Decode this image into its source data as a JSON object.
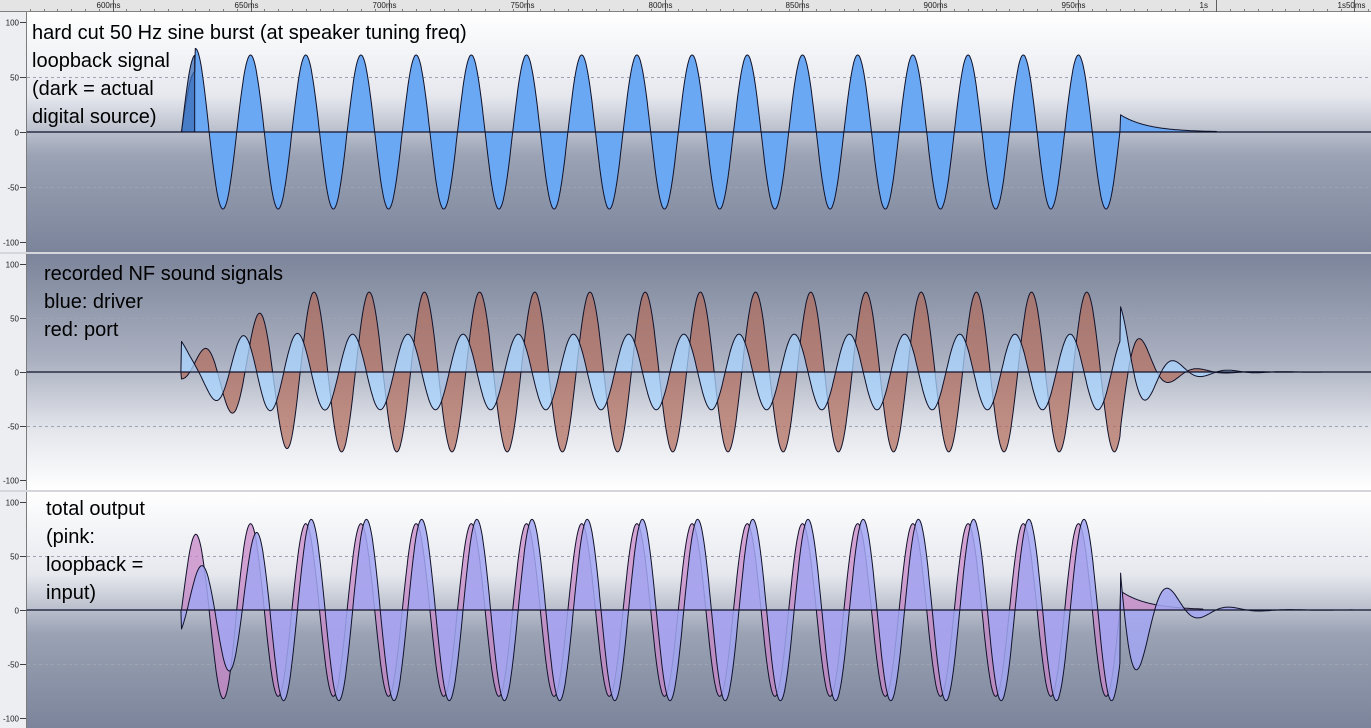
{
  "window": {
    "time_ruler": {
      "ticks": [
        {
          "t": 600,
          "label": "600ms"
        },
        {
          "t": 650,
          "label": "650ms"
        },
        {
          "t": 700,
          "label": "700ms"
        },
        {
          "t": 750,
          "label": "750ms"
        },
        {
          "t": 800,
          "label": "800ms"
        },
        {
          "t": 850,
          "label": "850ms"
        },
        {
          "t": 900,
          "label": "900ms"
        },
        {
          "t": 950,
          "label": "950ms"
        },
        {
          "t": 1000,
          "label": "1s"
        },
        {
          "t": 1050,
          "label": "1s50ms"
        }
      ]
    }
  },
  "colors": {
    "loopback_fill": "#6aa8f4",
    "loopback_dark": "#3c6fb8",
    "driver_fill": "#a8d4ff",
    "port_fill": "#b06a58",
    "total_fill": "#a2a6f2",
    "pink_fill": "#c888c8",
    "trace_line": "#10122a",
    "grid_line": "#a0a4b0"
  },
  "tracks": [
    {
      "annotation": [
        "hard cut 50 Hz sine burst (at speaker tuning freq)",
        "loopback signal",
        "(dark = actual",
        "digital source)"
      ]
    },
    {
      "annotation": [
        "recorded NF sound signals",
        "blue: driver",
        "red: port"
      ]
    },
    {
      "annotation": [
        "total output",
        "(pink:",
        "loopback =",
        "input)"
      ]
    }
  ],
  "chart_data": [
    {
      "type": "line",
      "title": "",
      "xlabel": "",
      "ylabel": "",
      "xlim": [
        569,
        1056
      ],
      "ylim": [
        -100,
        100
      ],
      "yticks": [
        {
          "v": 100,
          "label": "100"
        },
        {
          "v": 50,
          "label": "50"
        },
        {
          "v": 0,
          "label": "0"
        },
        {
          "v": -50,
          "label": "-50"
        },
        {
          "v": -100,
          "label": "-100"
        }
      ],
      "grid": true,
      "signal": "50 Hz sine burst 625-965 ms, approx. 20-cycle hard-cut tone burst",
      "series": [
        {
          "role": "digital_source",
          "x": [
            625,
            630,
            635,
            640,
            645,
            650,
            955,
            960,
            965,
            966
          ],
          "y": [
            0,
            70,
            0,
            -70,
            0,
            70,
            0,
            -70,
            0,
            0
          ]
        },
        {
          "role": "loopback",
          "x": [
            625,
            630,
            635,
            640,
            645,
            960,
            965,
            966,
            980,
            1000,
            1056
          ],
          "y": [
            0,
            55,
            0,
            -76,
            0,
            -70,
            0,
            16,
            6,
            0,
            0
          ]
        }
      ]
    },
    {
      "type": "line",
      "title": "",
      "xlabel": "",
      "ylabel": "",
      "xlim": [
        569,
        1056
      ],
      "ylim": [
        -100,
        100
      ],
      "yticks": [
        {
          "v": 100,
          "label": "100"
        },
        {
          "v": 50,
          "label": "50"
        },
        {
          "v": 0,
          "label": "0"
        },
        {
          "v": -50,
          "label": "-50"
        },
        {
          "v": -100,
          "label": "-100"
        }
      ],
      "grid": true,
      "series": [
        {
          "name": "driver",
          "x": [
            625,
            627,
            631,
            640,
            650,
            660,
            700,
            800,
            900,
            960,
            965,
            970,
            975,
            980,
            990,
            1000
          ],
          "y": [
            0,
            -45,
            58,
            -50,
            47,
            -35,
            35,
            35,
            35,
            -35,
            62,
            -33,
            29,
            -15,
            9,
            0
          ]
        },
        {
          "name": "port",
          "x": [
            625,
            630,
            640,
            648,
            658,
            668,
            700,
            800,
            900,
            960,
            965,
            970,
            980,
            1000
          ],
          "y": [
            0,
            8,
            45,
            -58,
            68,
            -72,
            74,
            74,
            74,
            -72,
            72,
            -50,
            -14,
            0
          ]
        }
      ]
    },
    {
      "type": "line",
      "title": "",
      "xlabel": "",
      "ylabel": "",
      "xlim": [
        569,
        1056
      ],
      "ylim": [
        -100,
        100
      ],
      "yticks": [
        {
          "v": 100,
          "label": "100"
        },
        {
          "v": 50,
          "label": "50"
        },
        {
          "v": 0,
          "label": "0"
        },
        {
          "v": -50,
          "label": "-50"
        },
        {
          "v": -100,
          "label": "-100"
        }
      ],
      "grid": true,
      "series": [
        {
          "name": "total output",
          "x": [
            625,
            627,
            631,
            638,
            648,
            658,
            700,
            800,
            900,
            960,
            965,
            970,
            975,
            980,
            1000
          ],
          "y": [
            0,
            -22,
            36,
            -45,
            60,
            -78,
            84,
            84,
            84,
            -84,
            100,
            -55,
            28,
            -15,
            0
          ]
        },
        {
          "name": "loopback",
          "x": [
            625,
            630,
            640,
            650,
            700,
            800,
            900,
            960,
            965,
            970,
            990,
            1000
          ],
          "y": [
            0,
            64,
            -90,
            75,
            80,
            80,
            80,
            -82,
            18,
            8,
            0,
            0
          ]
        }
      ]
    }
  ]
}
